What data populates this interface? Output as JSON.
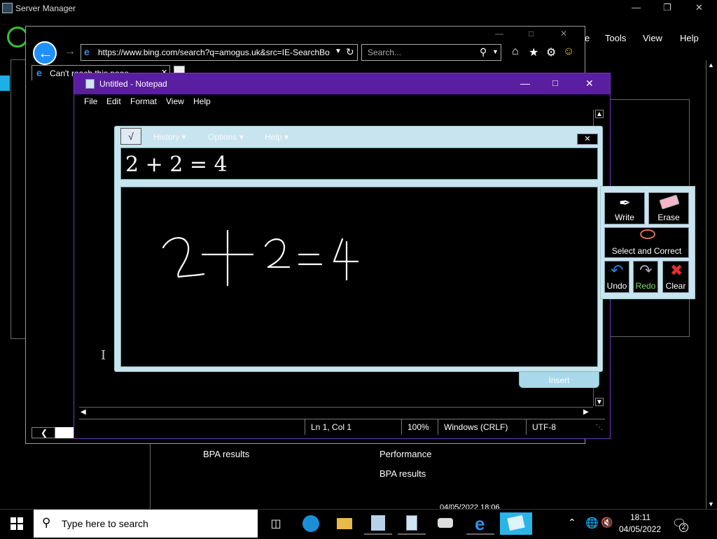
{
  "server_manager": {
    "title": "Server Manager",
    "menu": [
      "e",
      "Tools",
      "View",
      "Help"
    ],
    "bpa1": "BPA results",
    "performance": "Performance",
    "bpa2": "BPA results",
    "partial_timestamp": "04/05/2022 18:06"
  },
  "ie": {
    "address": "https://www.bing.com/search?q=amogus.uk&src=IE-SearchBo",
    "search_placeholder": "Search...",
    "tab_title": "Can't reach this page"
  },
  "notepad": {
    "title": "Untitled - Notepad",
    "menu": [
      "File",
      "Edit",
      "Format",
      "View",
      "Help"
    ],
    "status": {
      "position": "Ln 1, Col 1",
      "zoom": "100%",
      "line_endings": "Windows (CRLF)",
      "encoding": "UTF-8"
    }
  },
  "math_panel": {
    "menu": [
      "History",
      "Options",
      "Help"
    ],
    "result": "2 + 2 = 4",
    "insert_label": "Insert",
    "tools": {
      "write": "Write",
      "erase": "Erase",
      "select": "Select and Correct",
      "undo": "Undo",
      "redo": "Redo",
      "clear": "Clear"
    }
  },
  "taskbar": {
    "search_placeholder": "Type here to search",
    "time": "18:11",
    "date": "04/05/2022",
    "notification_count": "2"
  },
  "colors": {
    "notepad_titlebar": "#5a1ea0",
    "ie_back": "#1e90ff",
    "math_panel_bg": "#c8e4ef",
    "redo_green": "#7ddc6a"
  }
}
